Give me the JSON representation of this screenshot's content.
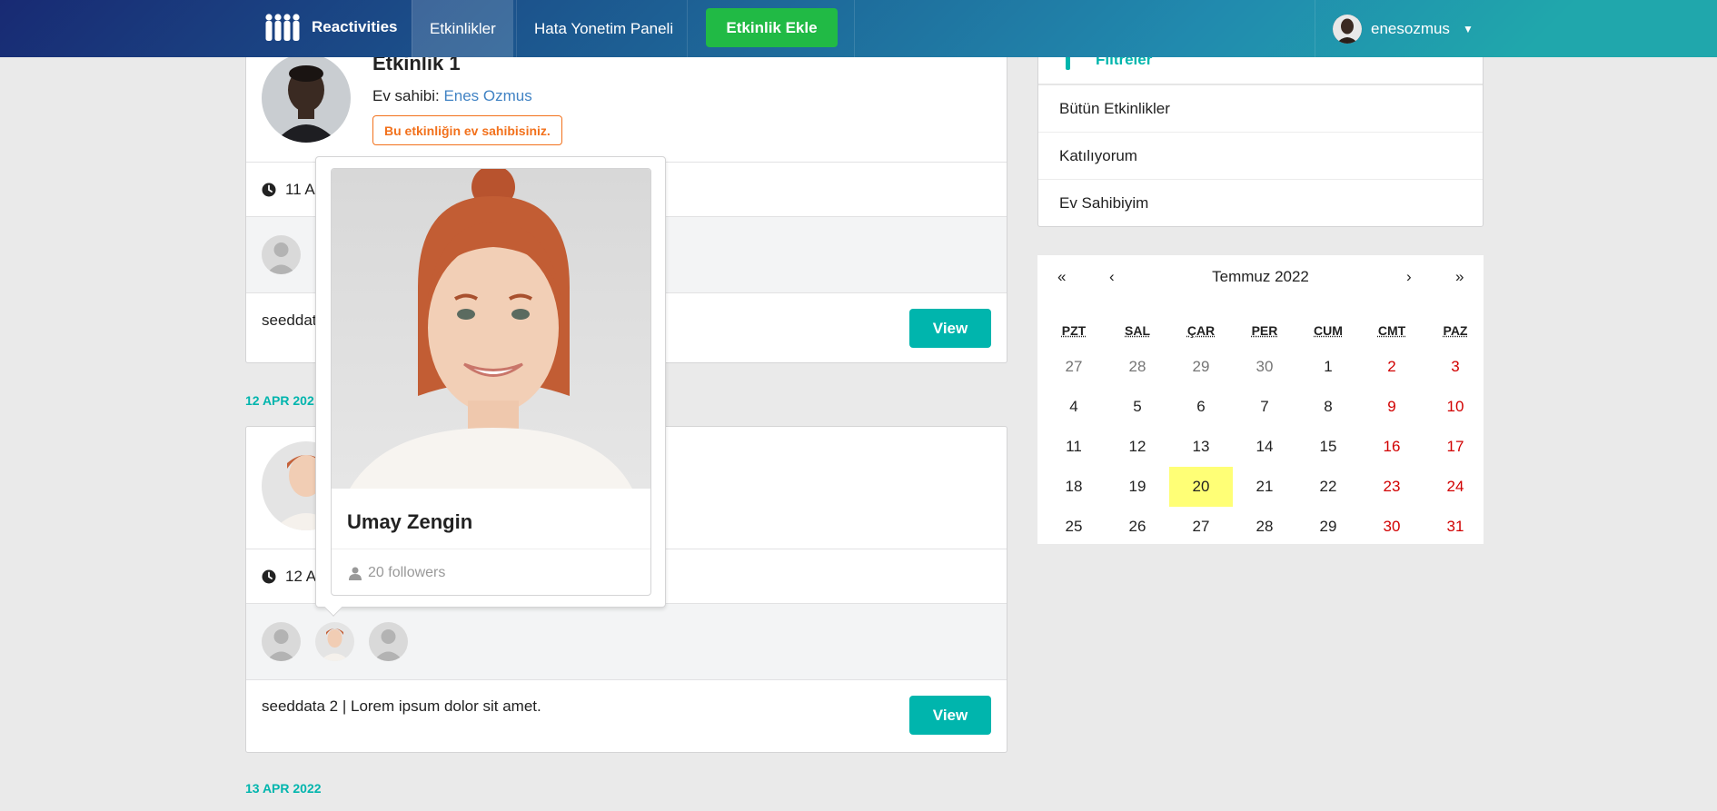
{
  "nav": {
    "brand": "Reactivities",
    "items": [
      "Etkinlikler",
      "Hata Yonetim Paneli"
    ],
    "add_button": "Etkinlik Ekle",
    "username": "enesozmus"
  },
  "activities": [
    {
      "title": "Etkinlik 1",
      "host_prefix": "Ev sahibi:",
      "host_name": "Enes Ozmus",
      "badge": "Bu etkinliğin ev sahibisiniz.",
      "date": "11 A",
      "description": "seeddat",
      "view": "View"
    },
    {
      "date": "12 A",
      "description": "seeddata 2 | Lorem ipsum dolor sit amet.",
      "view": "View"
    }
  ],
  "group_dates": [
    "12 APR 202",
    "13 APR 2022"
  ],
  "filters": {
    "header": "Filtreler",
    "items": [
      "Bütün Etkinlikler",
      "Katılıyorum",
      "Ev Sahibiyim"
    ]
  },
  "calendar": {
    "title": "Temmuz 2022",
    "nav": [
      "«",
      "‹",
      "›",
      "»"
    ],
    "weekdays": [
      "PZT",
      "SAL",
      "ÇAR",
      "PER",
      "CUM",
      "CMT",
      "PAZ"
    ],
    "weeks": [
      [
        27,
        28,
        29,
        30,
        1,
        2,
        3
      ],
      [
        4,
        5,
        6,
        7,
        8,
        9,
        10
      ],
      [
        11,
        12,
        13,
        14,
        15,
        16,
        17
      ],
      [
        18,
        19,
        20,
        21,
        22,
        23,
        24
      ],
      [
        25,
        26,
        27,
        28,
        29,
        30,
        31
      ]
    ],
    "today": 20
  },
  "profile_popup": {
    "name": "Umay Zengin",
    "followers": "20 followers"
  },
  "colors": {
    "teal": "#00b5ad",
    "green": "#21ba45",
    "orange": "#f2711c",
    "link": "#4183c4",
    "weekend": "#d10000",
    "today": "#ffff76"
  }
}
